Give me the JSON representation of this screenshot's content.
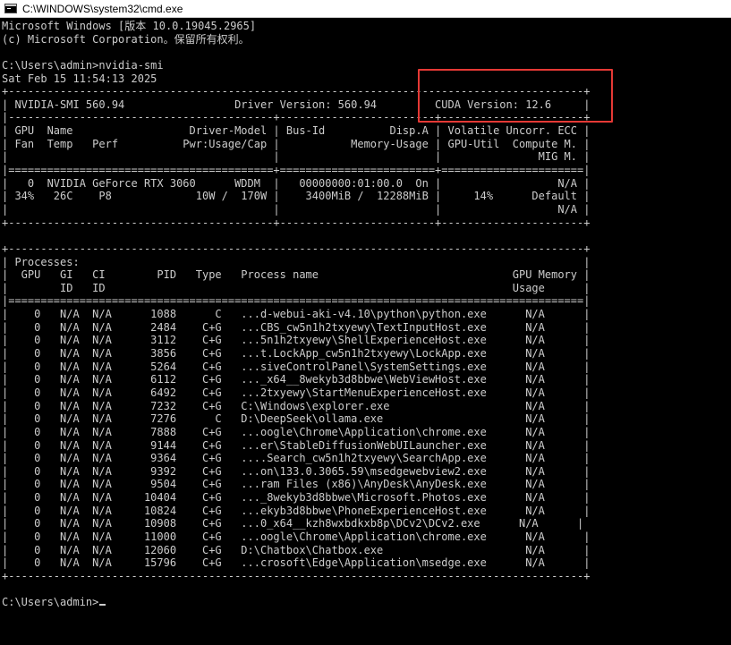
{
  "window": {
    "title": "C:\\WINDOWS\\system32\\cmd.exe",
    "icon": "console-window-icon"
  },
  "console": {
    "header_lines": [
      "Microsoft Windows [版本 10.0.19045.2965]",
      "(c) Microsoft Corporation。保留所有权利。",
      "",
      "C:\\Users\\admin>nvidia-smi",
      "Sat Feb 15 11:54:13 2025"
    ],
    "gpu_table_lines": [
      "+-----------------------------------------------------------------------------------------+",
      "| NVIDIA-SMI 560.94                 Driver Version: 560.94         CUDA Version: 12.6     |",
      "|-----------------------------------------+------------------------+----------------------+",
      "| GPU  Name                  Driver-Model | Bus-Id          Disp.A | Volatile Uncorr. ECC |",
      "| Fan  Temp   Perf          Pwr:Usage/Cap |           Memory-Usage | GPU-Util  Compute M. |",
      "|                                         |                        |               MIG M. |",
      "|=========================================+========================+======================|",
      "|   0  NVIDIA GeForce RTX 3060      WDDM  |   00000000:01:00.0  On |                  N/A |",
      "| 34%   26C    P8             10W /  170W |    3400MiB /  12288MiB |     14%      Default |",
      "|                                         |                        |                  N/A |",
      "+-----------------------------------------+------------------------+----------------------+",
      ""
    ],
    "process_table_lines": [
      "+-----------------------------------------------------------------------------------------+",
      "| Processes:                                                                              |",
      "|  GPU   GI   CI        PID   Type   Process name                              GPU Memory |",
      "|        ID   ID                                                               Usage      |",
      "|=========================================================================================|",
      "|    0   N/A  N/A      1088      C   ...d-webui-aki-v4.10\\python\\python.exe      N/A      |",
      "|    0   N/A  N/A      2484    C+G   ...CBS_cw5n1h2txyewy\\TextInputHost.exe      N/A      |",
      "|    0   N/A  N/A      3112    C+G   ...5n1h2txyewy\\ShellExperienceHost.exe      N/A      |",
      "|    0   N/A  N/A      3856    C+G   ...t.LockApp_cw5n1h2txyewy\\LockApp.exe      N/A      |",
      "|    0   N/A  N/A      5264    C+G   ...siveControlPanel\\SystemSettings.exe      N/A      |",
      "|    0   N/A  N/A      6112    C+G   ..._x64__8wekyb3d8bbwe\\WebViewHost.exe      N/A      |",
      "|    0   N/A  N/A      6492    C+G   ...2txyewy\\StartMenuExperienceHost.exe      N/A      |",
      "|    0   N/A  N/A      7232    C+G   C:\\Windows\\explorer.exe                     N/A      |",
      "|    0   N/A  N/A      7276      C   D:\\DeepSeek\\ollama.exe                      N/A      |",
      "|    0   N/A  N/A      7888    C+G   ...oogle\\Chrome\\Application\\chrome.exe      N/A      |",
      "|    0   N/A  N/A      9144    C+G   ...er\\StableDiffusionWebUILauncher.exe      N/A      |",
      "|    0   N/A  N/A      9364    C+G   ....Search_cw5n1h2txyewy\\SearchApp.exe      N/A      |",
      "|    0   N/A  N/A      9392    C+G   ...on\\133.0.3065.59\\msedgewebview2.exe      N/A      |",
      "|    0   N/A  N/A      9504    C+G   ...ram Files (x86)\\AnyDesk\\AnyDesk.exe      N/A      |",
      "|    0   N/A  N/A     10404    C+G   ..._8wekyb3d8bbwe\\Microsoft.Photos.exe      N/A      |",
      "|    0   N/A  N/A     10824    C+G   ...ekyb3d8bbwe\\PhoneExperienceHost.exe      N/A      |",
      "|    0   N/A  N/A     10908    C+G   ...0_x64__kzh8wxbdkxb8p\\DCv2\\DCv2.exe      N/A      |",
      "|    0   N/A  N/A     11000    C+G   ...oogle\\Chrome\\Application\\chrome.exe      N/A      |",
      "|    0   N/A  N/A     12060    C+G   D:\\Chatbox\\Chatbox.exe                      N/A      |",
      "|    0   N/A  N/A     15796    C+G   ...crosoft\\Edge\\Application\\msedge.exe      N/A      |",
      "+-----------------------------------------------------------------------------------------+",
      ""
    ],
    "prompt": "C:\\Users\\admin>"
  },
  "colors": {
    "console_background": "#000000",
    "console_text": "#cccccc",
    "highlight_border": "#e53935",
    "titlebar_background": "#ffffff"
  }
}
